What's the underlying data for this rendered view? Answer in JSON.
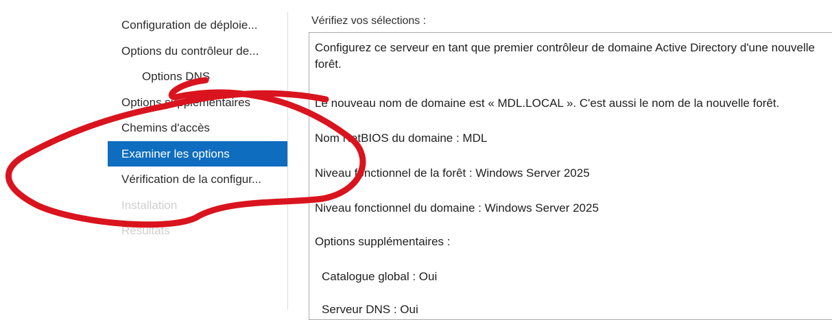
{
  "nav": {
    "items": [
      {
        "label": "Configuration de déploie...",
        "state": "normal"
      },
      {
        "label": "Options du contrôleur de...",
        "state": "normal"
      },
      {
        "label": "Options DNS",
        "state": "sub"
      },
      {
        "label": "Options supplémentaires",
        "state": "normal"
      },
      {
        "label": "Chemins d'accès",
        "state": "normal"
      },
      {
        "label": "Examiner les options",
        "state": "active"
      },
      {
        "label": "Vérification de la configur...",
        "state": "normal"
      },
      {
        "label": "Installation",
        "state": "disabled"
      },
      {
        "label": "Résultats",
        "state": "disabled"
      }
    ]
  },
  "review": {
    "heading": "Vérifiez vos sélections :",
    "lines": [
      "Configurez ce serveur en tant que premier contrôleur de domaine Active Directory d'une nouvelle forêt.",
      "Le nouveau nom de domaine est « MDL.LOCAL ». C'est aussi le nom de la nouvelle forêt.",
      "Nom NetBIOS du domaine : MDL",
      "Niveau fonctionnel de la forêt : Windows Server 2025",
      "Niveau fonctionnel du domaine : Windows Server 2025",
      "Options supplémentaires :",
      "Catalogue global : Oui",
      "Serveur DNS : Oui"
    ]
  },
  "colors": {
    "accent": "#0f6dbf",
    "annotation": "#d9141e",
    "disabled_text": "#cfcfcf"
  }
}
